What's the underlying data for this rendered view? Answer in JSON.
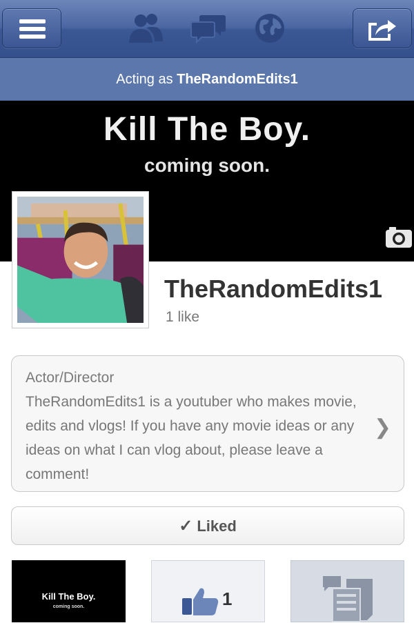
{
  "nav": {
    "icons": [
      "menu-icon",
      "friends-icon",
      "messages-icon",
      "globe-icon",
      "share-icon"
    ]
  },
  "acting": {
    "prefix": "Acting as",
    "name": "TheRandomEdits1"
  },
  "cover": {
    "title": "Kill The Boy.",
    "subtitle": "coming soon."
  },
  "page": {
    "name": "TheRandomEdits1",
    "likes": "1 like"
  },
  "about": {
    "category": "Actor/Director",
    "description": "TheRandomEdits1 is a youtuber who makes movie, edits and vlogs! If you have any movie ideas or any ideas on what I can vlog about, please leave a comment!"
  },
  "like_button": {
    "label": "Liked"
  },
  "tiles": {
    "cover_title": "Kill The Boy.",
    "cover_sub": "coming soon.",
    "like_count": "1"
  },
  "colors": {
    "nav_blue": "#3b5894",
    "acting_blue": "#5b77ac",
    "cover_black": "#000000"
  }
}
